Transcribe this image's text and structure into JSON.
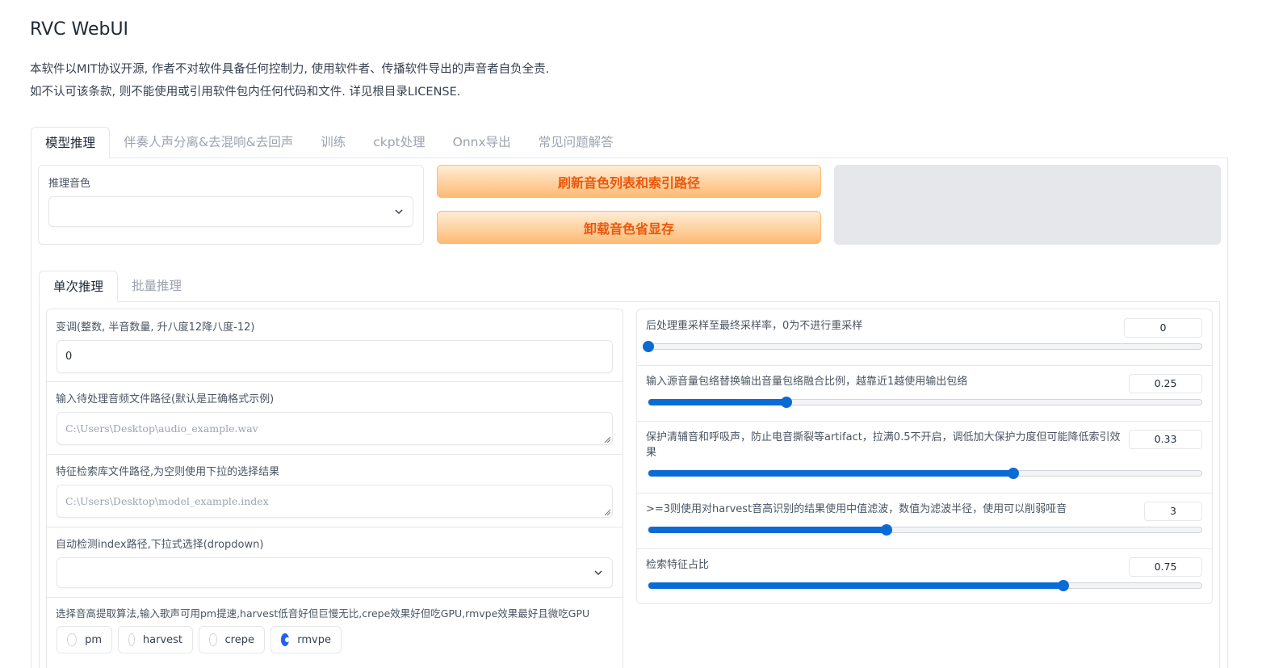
{
  "app": {
    "title": "RVC WebUI",
    "description_line1": "本软件以MIT协议开源, 作者不对软件具备任何控制力, 使用软件者、传播软件导出的声音者自负全责.",
    "description_line2": "如不认可该条款, 则不能使用或引用软件包内任何代码和文件. 详见根目录LICENSE."
  },
  "main_tabs": [
    {
      "label": "模型推理",
      "selected": true
    },
    {
      "label": "伴奏人声分离&去混响&去回声",
      "selected": false
    },
    {
      "label": "训练",
      "selected": false
    },
    {
      "label": "ckpt处理",
      "selected": false
    },
    {
      "label": "Onnx导出",
      "selected": false
    },
    {
      "label": "常见问题解答",
      "selected": false
    }
  ],
  "model_panel": {
    "voice_label": "推理音色",
    "voice_value": "",
    "refresh_button": "刷新音色列表和索引路径",
    "unload_button": "卸载音色省显存"
  },
  "sub_tabs": [
    {
      "label": "单次推理",
      "selected": true
    },
    {
      "label": "批量推理",
      "selected": false
    }
  ],
  "left": {
    "transpose_label": "变调(整数, 半音数量, 升八度12降八度-12)",
    "transpose_value": "0",
    "audio_path_label": "输入待处理音频文件路径(默认是正确格式示例)",
    "audio_path_placeholder": "C:\\Users\\Desktop\\audio_example.wav",
    "index_path_label": "特征检索库文件路径,为空则使用下拉的选择结果",
    "index_path_placeholder": "C:\\Users\\Desktop\\model_example.index",
    "auto_index_label": "自动检测index路径,下拉式选择(dropdown)",
    "auto_index_value": "",
    "f0_label": "选择音高提取算法,输入歌声可用pm提速,harvest低音好但巨慢无比,crepe效果好但吃GPU,rmvpe效果最好且微吃GPU",
    "f0_options": [
      {
        "label": "pm",
        "checked": false
      },
      {
        "label": "harvest",
        "checked": false
      },
      {
        "label": "crepe",
        "checked": false
      },
      {
        "label": "rmvpe",
        "checked": true
      }
    ]
  },
  "right": {
    "sliders": [
      {
        "label": "后处理重采样至最终采样率，0为不进行重采样",
        "value": "0",
        "fraction": 0.0
      },
      {
        "label": "输入源音量包络替换输出音量包络融合比例，越靠近1越使用输出包络",
        "value": "0.25",
        "fraction": 0.25
      },
      {
        "label": "保护清辅音和呼吸声，防止电音撕裂等artifact，拉满0.5不开启，调低加大保护力度但可能降低索引效果",
        "value": "0.33",
        "fraction": 0.66
      },
      {
        "label": ">=3则使用对harvest音高识别的结果使用中值滤波，数值为滤波半径，使用可以削弱哑音",
        "value": "3",
        "fraction": 0.43
      },
      {
        "label": "检索特征占比",
        "value": "0.75",
        "fraction": 0.75
      }
    ]
  },
  "colors": {
    "accent": "#0a6bd6",
    "orange_text": "#ea580c",
    "border": "#e5e7eb"
  }
}
